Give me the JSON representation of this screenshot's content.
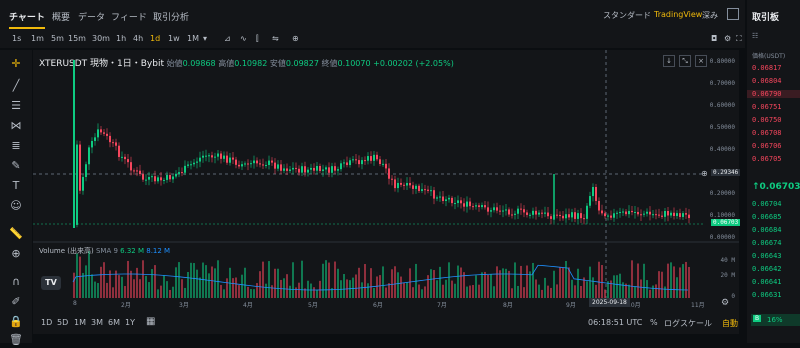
{
  "header": {
    "tabs": [
      "チャート",
      "概要",
      "データ",
      "フィード",
      "取引分析"
    ],
    "views": [
      "スタンダード",
      "TradingView",
      "深み"
    ]
  },
  "intervals": [
    "1s",
    "1m",
    "5m",
    "15m",
    "30m",
    "1h",
    "4h",
    "1d",
    "1w",
    "1M"
  ],
  "active_interval": "1d",
  "symbol_line": {
    "symbol": "XTERUSDT 現物・1日・Bybit",
    "open_label": "始値",
    "open": "0.09868",
    "high_label": "高値",
    "high": "0.10982",
    "low_label": "安値",
    "low": "0.09827",
    "close_label": "終値",
    "close": "0.10070",
    "change": "+0.00202 (+2.05%)"
  },
  "price_axis": [
    "0.80000",
    "0.70000",
    "0.60000",
    "0.50000",
    "0.40000",
    "0.30000",
    "0.20000",
    "0.10000",
    "0.00000"
  ],
  "crosshair_price": "0.29346",
  "last_price": "0.06703",
  "volume_label": "Volume (出来高)",
  "volume_sma": "SMA 9",
  "volume_v1": "6.32 M",
  "volume_v2": "8.12 M",
  "volume_axis": [
    "40 M",
    "20 M",
    "0"
  ],
  "months": [
    "8",
    "2月",
    "3月",
    "4月",
    "5月",
    "6月",
    "7月",
    "8月",
    "9月",
    "10月",
    "11月"
  ],
  "crosshair_date": "2025-09-18",
  "ranges": [
    "1D",
    "5D",
    "1M",
    "3M",
    "6M",
    "1Y"
  ],
  "clock": "06:18:51 UTC",
  "pct": "%",
  "log_scale": "ログスケール",
  "auto": "自動",
  "orderbook": {
    "title": "取引板",
    "price_label": "価格(USDT)",
    "asks": [
      "0.06817",
      "0.06804",
      "0.06790",
      "0.06751",
      "0.06750",
      "0.06708",
      "0.06706",
      "0.06705"
    ],
    "mid": "0.06703",
    "bids": [
      "0.06704",
      "0.06685",
      "0.06684",
      "0.06674",
      "0.06643",
      "0.06642",
      "0.06641",
      "0.06631"
    ],
    "bid_pct": "16%"
  },
  "colors": {
    "up": "#0ecb81",
    "down": "#f6465d",
    "accent": "#f0b90b"
  }
}
